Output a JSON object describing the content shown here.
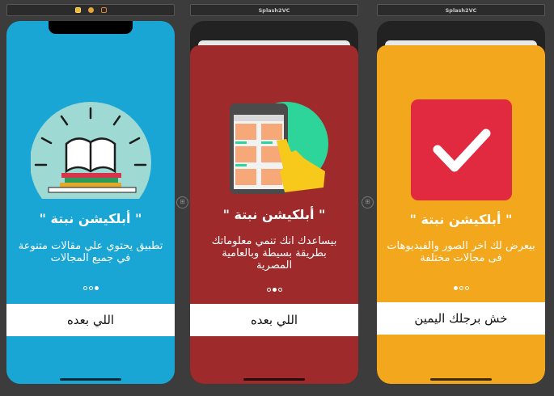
{
  "storyboard": {
    "scene2_title": "Splash2VC",
    "scene3_title": "Splash2VC"
  },
  "screens": [
    {
      "title": "\" أبلكيشن نبتة \"",
      "description": "تطبيق يحتوي علي مقالات متنوعة في جميع المجالات",
      "button": "اللي بعده",
      "background": "#19a6d5",
      "illustration": "book-icon",
      "active_page": 1
    },
    {
      "title": "\" أبلكيشن نبتة \"",
      "description": "بيساعدك انك تنمي معلوماتك بطريقة بسيطة وبالعامية المصرية",
      "button": "اللي بعده",
      "background": "#9e2a2b",
      "illustration": "phone-hand-icon",
      "active_page": 2
    },
    {
      "title": "\" أبلكيشن نبتة \"",
      "description": "بيعرض لك اخر الصور والفيديوهات فى مجالات مختلفة",
      "button": "خش برجلك اليمين",
      "background": "#f2a71c",
      "illustration": "checkmark-icon",
      "active_page": 3
    }
  ]
}
